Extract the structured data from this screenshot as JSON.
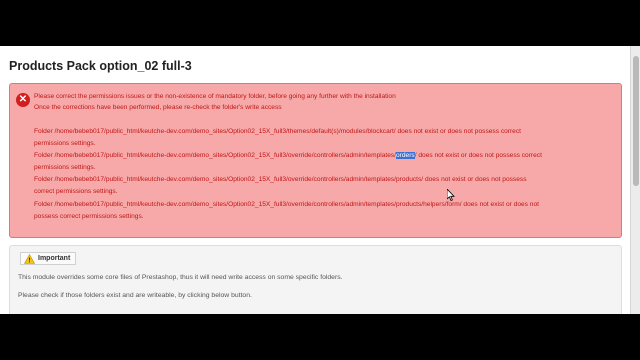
{
  "page": {
    "title": "Products Pack option_02 full-3"
  },
  "error": {
    "line1": "Please correct the permissions issues or the non-existence of mandatory folder, before going any further with the installation",
    "line2": "Once the corrections have been performed, please re-check the folder's write access",
    "folders": [
      {
        "text1": "Folder /home/bebeb017/public_html/keutche-dev.com/demo_sites/Option02_15X_full3/themes/default(s)/modules/blockcart/ does not exist or does not possess correct",
        "text2": "permissions settings."
      },
      {
        "pre": "Folder /home/bebeb017/public_html/keutche-dev.com/demo_sites/Option02_15X_full3/override/controllers/admin/templates/",
        "highlight": "orders",
        "post": "/ does not exist or does not possess correct",
        "text2": "permissions settings."
      },
      {
        "text1": "Folder /home/bebeb017/public_html/keutche-dev.com/demo_sites/Option02_15X_full3/override/controllers/admin/templates/products/ does not exist or does not possess",
        "text2": "correct permissions settings."
      },
      {
        "text1": "Folder /home/bebeb017/public_html/keutche-dev.com/demo_sites/Option02_15X_full3/override/controllers/admin/templates/products/helpers/form/ does not exist or does not",
        "text2": "possess correct permissions settings."
      }
    ],
    "icon": "error-x-icon",
    "colors": {
      "background": "#f7a9a9",
      "text": "#c01616",
      "border": "#e47575"
    }
  },
  "important": {
    "title": "Important",
    "icon": "warning-icon",
    "line1": "This module overrides some core files of Prestashop, thus it will need write access on some specific folders.",
    "line2": "Please check if those folders exist and are writeable, by clicking below button."
  }
}
